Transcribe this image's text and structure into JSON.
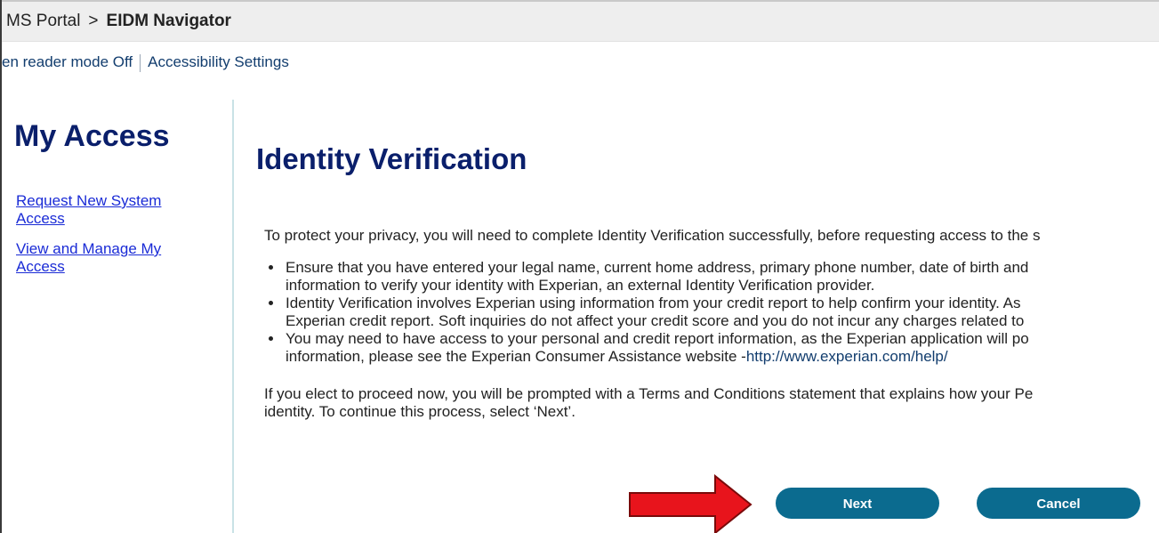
{
  "breadcrumb": {
    "root": "MS Portal",
    "separator": ">",
    "current": "EIDM Navigator"
  },
  "accessibility_bar": {
    "screen_reader": "en reader mode Off",
    "settings": "Accessibility Settings"
  },
  "sidebar": {
    "title": "My Access",
    "links": [
      {
        "line1": "Request New System",
        "line2": "Access"
      },
      {
        "line1": "View and Manage My",
        "line2": "Access"
      }
    ]
  },
  "main": {
    "title": "Identity Verification",
    "intro": "To protect your privacy, you will need to complete Identity Verification successfully, before requesting access to the s",
    "bullets": [
      {
        "line1": "Ensure that you have entered your legal name, current home address, primary phone number, date of birth and",
        "line2": "information to verify your identity with Experian, an external Identity Verification provider."
      },
      {
        "line1": "Identity Verification involves Experian using information from your credit report to help confirm your identity. As",
        "line2": "Experian credit report. Soft inquiries do not affect your credit score and you do not incur any charges related to"
      },
      {
        "line1": "You may need to have access to your personal and credit report information, as the Experian application will po",
        "line2_prefix": "information, please see the Experian Consumer Assistance website -",
        "line2_link": "http://www.experian.com/help/"
      }
    ],
    "outro_line1": "If you elect to proceed now, you will be prompted with a Terms and Conditions statement that explains how your Pe",
    "outro_line2": "identity. To continue this process, select ‘Next’."
  },
  "buttons": {
    "next": "Next",
    "cancel": "Cancel"
  },
  "colors": {
    "heading": "#0a1f6b",
    "link": "#1a2bd6",
    "button": "#0b6b8f",
    "arrow": "#e8141c"
  }
}
